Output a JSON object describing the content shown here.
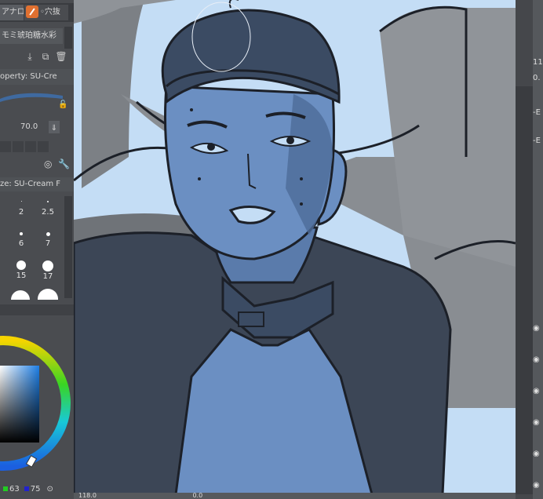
{
  "left_panel": {
    "tabs": [
      "アナロ",
      "◦穴抜"
    ],
    "subtool_name": "モミ琥珀糖水彩",
    "property_title": "operty: SU-Cre",
    "opacity_value": "70.0",
    "brush_size_title": "ze: SU-Cream F",
    "sizes": [
      "2",
      "2.5",
      "6",
      "7",
      "15",
      "17"
    ],
    "color_values": [
      "63",
      "75"
    ]
  },
  "canvas": {
    "zoom_text": "118.0",
    "angle_text": "0.0"
  },
  "right_panel": {
    "values": [
      "11",
      "0."
    ],
    "labels": [
      "-E",
      "-E"
    ]
  },
  "colors": {
    "sky": "#c4ddf5",
    "skin": "#6b8fc2",
    "shadow": "#3b4b63",
    "jacket": "#3c4656",
    "line": "#1c2028"
  }
}
